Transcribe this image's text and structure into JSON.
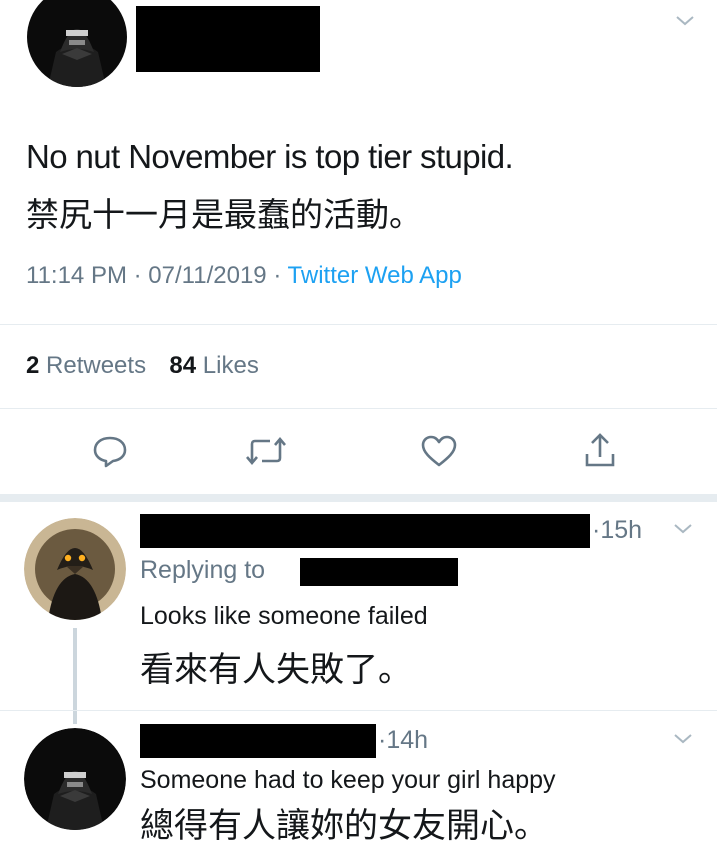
{
  "tweet": {
    "text_en": "No nut November is top tier stupid.",
    "text_zh": "禁尻十一月是最蠢的活動。",
    "time": "11:14 PM",
    "date": "07/11/2019",
    "source": "Twitter Web App",
    "retweets_count": "2",
    "retweets_label": "Retweets",
    "likes_count": "84",
    "likes_label": "Likes",
    "actions": [
      "reply-icon",
      "retweet-icon",
      "like-icon",
      "share-icon"
    ]
  },
  "reply1": {
    "time": "15h",
    "replying_to_label": "Replying to",
    "text_en": "Looks like someone failed",
    "text_zh": "看來有人失敗了。"
  },
  "reply2": {
    "time": "14h",
    "text_en": "Someone had to keep your girl happy",
    "text_zh": "總得有人讓妳的女友開心。"
  },
  "colors": {
    "text": "#14171a",
    "secondary": "#657786",
    "link": "#1da1f2",
    "divider": "#e6ecf0"
  },
  "separator": "·"
}
